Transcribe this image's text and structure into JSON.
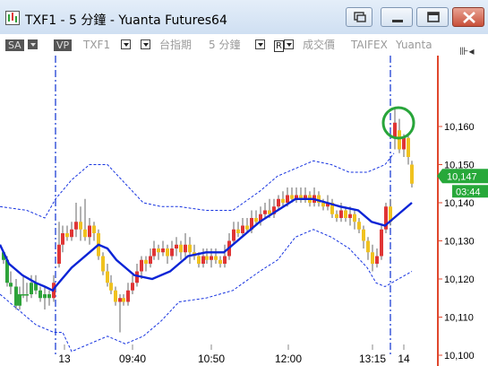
{
  "window": {
    "title": "TXF1 - 5 分鐘 - Yuanta Futures64",
    "buttons": [
      "restore-down",
      "minimize",
      "maximize",
      "close"
    ]
  },
  "toolbar": {
    "sa_label": "SA",
    "vp_label": "VP",
    "symbol": "TXF1",
    "product": "台指期",
    "interval": "5 分鐘",
    "r_label": "R",
    "price_type": "成交價",
    "exchange": "TAIFEX",
    "broker": "Yuanta"
  },
  "price_badges": {
    "last_price": "10,147",
    "time_left": "03:44"
  },
  "colors": {
    "up": "#e03535",
    "down_or_flat": "#f0c21f",
    "green_candle": "#2ea33a",
    "ma": "#0b24d6",
    "band": "#1633e0",
    "session": "#1d3fd4",
    "axis": "#e0472d",
    "badge": "#27a83a",
    "circle": "#28a53a"
  },
  "chart_data": {
    "type": "candlestick",
    "y_axis": {
      "ticks": [
        "10,160",
        "10,150",
        "10,140",
        "10,130",
        "10,120",
        "10,110",
        "10,100"
      ],
      "range": [
        10100,
        10165
      ]
    },
    "x_axis": {
      "ticks": [
        "13",
        "09:40",
        "10:50",
        "12:00",
        "13:15",
        "14"
      ]
    },
    "session_lines": [
      "13",
      "14"
    ],
    "last_price": 10147,
    "ma_path": [
      [
        0,
        10129
      ],
      [
        10,
        10124
      ],
      [
        25,
        10121
      ],
      [
        40,
        10119
      ],
      [
        50,
        10118
      ],
      [
        59,
        10117
      ],
      [
        62,
        10118
      ],
      [
        80,
        10123
      ],
      [
        100,
        10127
      ],
      [
        110,
        10129
      ],
      [
        120,
        10128
      ],
      [
        130,
        10125
      ],
      [
        150,
        10121
      ],
      [
        170,
        10120
      ],
      [
        190,
        10122
      ],
      [
        210,
        10126
      ],
      [
        230,
        10127
      ],
      [
        250,
        10127
      ],
      [
        270,
        10131
      ],
      [
        290,
        10135
      ],
      [
        310,
        10138
      ],
      [
        330,
        10141
      ],
      [
        350,
        10141
      ],
      [
        365,
        10140
      ],
      [
        380,
        10139
      ],
      [
        400,
        10138
      ],
      [
        415,
        10135
      ],
      [
        430,
        10134
      ],
      [
        440,
        10136
      ],
      [
        460,
        10140
      ]
    ],
    "band_upper": [
      [
        0,
        10139
      ],
      [
        30,
        10138
      ],
      [
        50,
        10136
      ],
      [
        62,
        10141
      ],
      [
        80,
        10146
      ],
      [
        100,
        10150
      ],
      [
        120,
        10150
      ],
      [
        140,
        10145
      ],
      [
        160,
        10140
      ],
      [
        180,
        10139
      ],
      [
        200,
        10139
      ],
      [
        230,
        10138
      ],
      [
        260,
        10138
      ],
      [
        290,
        10143
      ],
      [
        310,
        10147
      ],
      [
        330,
        10149
      ],
      [
        350,
        10151
      ],
      [
        370,
        10150
      ],
      [
        390,
        10148
      ],
      [
        410,
        10148
      ],
      [
        430,
        10150
      ],
      [
        440,
        10153
      ]
    ],
    "band_lower": [
      [
        0,
        10116
      ],
      [
        20,
        10112
      ],
      [
        40,
        10108
      ],
      [
        60,
        10106
      ],
      [
        70,
        10106
      ],
      [
        80,
        10101
      ],
      [
        100,
        10103
      ],
      [
        120,
        10105
      ],
      [
        140,
        10103
      ],
      [
        160,
        10105
      ],
      [
        180,
        10109
      ],
      [
        200,
        10114
      ],
      [
        230,
        10115
      ],
      [
        260,
        10117
      ],
      [
        290,
        10122
      ],
      [
        310,
        10125
      ],
      [
        330,
        10131
      ],
      [
        350,
        10133
      ],
      [
        370,
        10131
      ],
      [
        390,
        10128
      ],
      [
        410,
        10123
      ],
      [
        420,
        10119
      ],
      [
        430,
        10118
      ],
      [
        445,
        10120
      ],
      [
        460,
        10122
      ]
    ],
    "candles": [
      [
        4,
        10127,
        10125,
        10127.5,
        10124
      ],
      [
        8,
        10125,
        10119,
        10126,
        10118
      ],
      [
        12,
        10119,
        10118,
        10122,
        10116
      ],
      [
        18,
        10118,
        10113,
        10120,
        10112
      ],
      [
        22,
        10113,
        10116,
        10118,
        10112
      ],
      [
        26,
        10116,
        10116,
        10121,
        10115
      ],
      [
        30,
        10116,
        10116,
        10119,
        10114
      ],
      [
        35,
        10116,
        10119,
        10121,
        10115
      ],
      [
        40,
        10119,
        10117,
        10121,
        10116
      ],
      [
        45,
        10117,
        10115,
        10118,
        10114
      ],
      [
        50,
        10115,
        10116,
        10118,
        10112
      ],
      [
        55,
        10116,
        10115,
        10117,
        10113
      ],
      [
        60,
        10115,
        10119,
        10121,
        10114
      ],
      [
        66,
        10124,
        10129,
        10135,
        10123
      ],
      [
        70,
        10129,
        10132,
        10134,
        10127
      ],
      [
        75,
        10132,
        10131,
        10134,
        10130
      ],
      [
        80,
        10131,
        10133,
        10135,
        10130
      ],
      [
        85,
        10133,
        10135,
        10140,
        10131
      ],
      [
        90,
        10135,
        10133,
        10139,
        10130
      ],
      [
        95,
        10133,
        10131,
        10141,
        10130
      ],
      [
        100,
        10131,
        10134,
        10136,
        10129
      ],
      [
        105,
        10134,
        10132,
        10135,
        10130
      ],
      [
        110,
        10132,
        10126,
        10133,
        10125
      ],
      [
        115,
        10126,
        10122,
        10127,
        10121
      ],
      [
        120,
        10122,
        10119,
        10124,
        10118
      ],
      [
        124,
        10119,
        10117,
        10121,
        10116
      ],
      [
        129,
        10117,
        10114,
        10118,
        10113
      ],
      [
        134,
        10114,
        10115,
        10116,
        10106
      ],
      [
        138,
        10115,
        10114,
        10116,
        10113
      ],
      [
        143,
        10114,
        10117,
        10119,
        10113
      ],
      [
        148,
        10117,
        10119,
        10121,
        10116
      ],
      [
        153,
        10119,
        10122,
        10124,
        10118
      ],
      [
        158,
        10122,
        10125,
        10126,
        10120
      ],
      [
        163,
        10125,
        10124,
        10126,
        10122
      ],
      [
        168,
        10124,
        10126,
        10128,
        10123
      ],
      [
        172,
        10126,
        10128,
        10130,
        10125
      ],
      [
        177,
        10128,
        10127,
        10129,
        10125
      ],
      [
        182,
        10127,
        10128,
        10130,
        10126
      ],
      [
        187,
        10128,
        10126,
        10129,
        10124
      ],
      [
        192,
        10126,
        10128,
        10130,
        10125
      ],
      [
        197,
        10128,
        10129,
        10131,
        10126
      ],
      [
        202,
        10129,
        10127,
        10130,
        10125
      ],
      [
        207,
        10127,
        10129,
        10132,
        10125
      ],
      [
        212,
        10129,
        10127,
        10131,
        10124
      ],
      [
        217,
        10127,
        10126,
        10129,
        10125
      ],
      [
        222,
        10126,
        10124,
        10127,
        10123
      ],
      [
        227,
        10124,
        10126,
        10128,
        10123
      ],
      [
        231,
        10126,
        10125,
        10128,
        10124
      ],
      [
        236,
        10125,
        10126,
        10128,
        10123
      ],
      [
        241,
        10126,
        10125,
        10128,
        10124
      ],
      [
        246,
        10125,
        10124,
        10126,
        10123
      ],
      [
        251,
        10124,
        10126,
        10129,
        10123
      ],
      [
        256,
        10126,
        10130,
        10132,
        10125
      ],
      [
        261,
        10130,
        10133,
        10135,
        10129
      ],
      [
        266,
        10133,
        10132,
        10135,
        10131
      ],
      [
        271,
        10132,
        10134,
        10136,
        10131
      ],
      [
        276,
        10134,
        10133,
        10136,
        10132
      ],
      [
        281,
        10133,
        10136,
        10138,
        10132
      ],
      [
        286,
        10136,
        10135,
        10138,
        10134
      ],
      [
        291,
        10135,
        10137,
        10139,
        10134
      ],
      [
        296,
        10137,
        10138,
        10140,
        10136
      ],
      [
        301,
        10138,
        10137,
        10141,
        10136
      ],
      [
        306,
        10137,
        10139,
        10141,
        10136
      ],
      [
        311,
        10139,
        10141,
        10142,
        10138
      ],
      [
        316,
        10141,
        10140,
        10143,
        10139
      ],
      [
        321,
        10140,
        10142,
        10144,
        10139
      ],
      [
        326,
        10142,
        10141,
        10144,
        10140
      ],
      [
        331,
        10141,
        10142,
        10144,
        10140
      ],
      [
        336,
        10142,
        10141,
        10144,
        10140
      ],
      [
        341,
        10141,
        10142,
        10144,
        10140
      ],
      [
        346,
        10142,
        10140,
        10143,
        10139
      ],
      [
        351,
        10140,
        10142,
        10144,
        10139
      ],
      [
        356,
        10142,
        10140,
        10143,
        10139
      ],
      [
        361,
        10140,
        10139,
        10141,
        10138
      ],
      [
        366,
        10139,
        10140,
        10142,
        10138
      ],
      [
        371,
        10140,
        10137,
        10141,
        10136
      ],
      [
        376,
        10137,
        10136,
        10138,
        10135
      ],
      [
        381,
        10136,
        10138,
        10140,
        10135
      ],
      [
        386,
        10138,
        10136,
        10139,
        10135
      ],
      [
        391,
        10136,
        10137,
        10139,
        10134
      ],
      [
        396,
        10137,
        10135,
        10138,
        10133
      ],
      [
        401,
        10135,
        10133,
        10136,
        10132
      ],
      [
        406,
        10133,
        10130,
        10134,
        10128
      ],
      [
        411,
        10130,
        10127,
        10131,
        10125
      ],
      [
        416,
        10127,
        10124,
        10129,
        10122
      ],
      [
        421,
        10124,
        10126,
        10128,
        10123
      ],
      [
        426,
        10126,
        10133,
        10134,
        10125
      ],
      [
        431,
        10133,
        10139,
        10140,
        10132
      ],
      [
        436,
        10139,
        10135,
        10141,
        10134
      ],
      [
        441,
        10157,
        10161,
        10165,
        10154
      ],
      [
        446,
        10159,
        10154,
        10162,
        10153
      ],
      [
        451,
        10154,
        10157,
        10158,
        10152
      ],
      [
        456,
        10157,
        10152,
        10158,
        10150
      ],
      [
        460,
        10150,
        10145,
        10151,
        10144
      ]
    ]
  }
}
